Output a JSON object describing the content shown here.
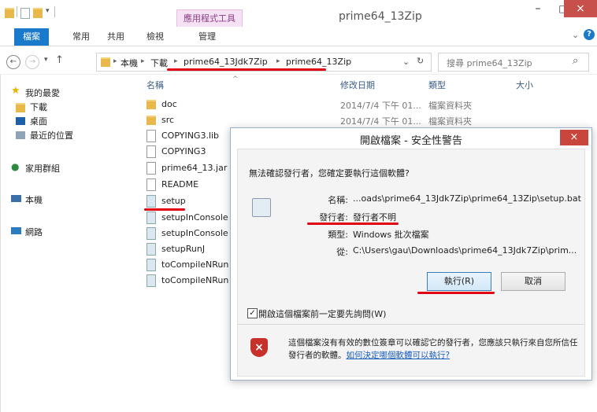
{
  "window": {
    "tool_tab": "應用程式工具",
    "title": "prime64_13Zip",
    "min_label": "–",
    "max_label": "□",
    "close_label": "×"
  },
  "ribbon": {
    "tabs": [
      "檔案",
      "常用",
      "共用",
      "檢視",
      "管理"
    ],
    "expand": "⌄",
    "help": "?"
  },
  "address": {
    "back": "←",
    "forward": "→",
    "recent": "▾",
    "up": "↑",
    "crumbs": [
      "本機",
      "下載",
      "prime64_13Jdk7Zip",
      "prime64_13Zip"
    ],
    "sep": "▸",
    "dropdown": "⌄",
    "refresh": "↻",
    "search_placeholder": "搜尋 prime64_13Zip",
    "search_icon": "⌕"
  },
  "nav": {
    "favorites": "我的最愛",
    "downloads": "下載",
    "desktop": "桌面",
    "recent": "最近的位置",
    "homegroup": "家用群組",
    "thispc": "本機",
    "network": "網路"
  },
  "columns": {
    "name": "名稱",
    "date": "修改日期",
    "type": "類型",
    "size": "大小",
    "sort_arrow": "^"
  },
  "files": [
    {
      "name": "doc",
      "icon": "folder-icon",
      "date": "2014/7/4 下午 01...",
      "type": "檔案資料夾"
    },
    {
      "name": "src",
      "icon": "folder-icon",
      "date": "2014/7/4 下午 01...",
      "type": "檔案資料夾"
    },
    {
      "name": "COPYING3.lib",
      "icon": "file-icon"
    },
    {
      "name": "COPYING3",
      "icon": "file-icon"
    },
    {
      "name": "prime64_13.jar",
      "icon": "file-icon"
    },
    {
      "name": "README",
      "icon": "file-icon"
    },
    {
      "name": "setup",
      "icon": "batch-icon"
    },
    {
      "name": "setupInConsole",
      "icon": "batch-icon"
    },
    {
      "name": "setupInConsoleF",
      "icon": "batch-icon"
    },
    {
      "name": "setupRunJ",
      "icon": "batch-icon"
    },
    {
      "name": "toCompileNRun",
      "icon": "batch-icon"
    },
    {
      "name": "toCompileNRun",
      "icon": "batch-icon"
    }
  ],
  "dialog": {
    "title": "開啟檔案 - 安全性警告",
    "close": "×",
    "question": "無法確認發行者，您確定要執行這個軟體?",
    "name_label": "名稱:",
    "name_value": "...oads\\prime64_13Jdk7Zip\\prime64_13Zip\\setup.bat",
    "publisher_label": "發行者:",
    "publisher_value": "發行者不明",
    "type_label": "類型:",
    "type_value": "Windows 批次檔案",
    "from_label": "從:",
    "from_value": "C:\\Users\\gau\\Downloads\\prime64_13Jdk7Zip\\prim...",
    "run_button": "執行(R)",
    "cancel_button": "取消",
    "checkbox_label": "開啟這個檔案前一定要先詢問(W)",
    "checkbox_checked": true,
    "warning_text": "這個檔案沒有有效的數位簽章可以確認它的發行者，您應該只執行來自您所信任發行者的軟體。",
    "warning_link": "如何決定哪個軟體可以執行?"
  },
  "colors": {
    "accent": "#1979ca",
    "annotation_red": "#e00012",
    "tool_tab_bg": "#f6e2f4"
  }
}
